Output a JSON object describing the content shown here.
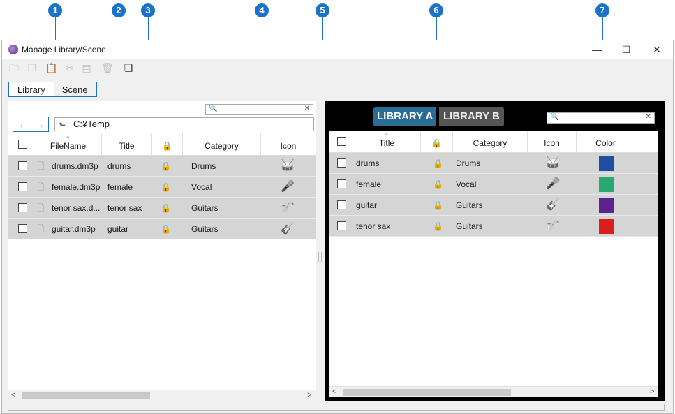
{
  "window": {
    "title": "Manage Library/Scene",
    "minimize": "—",
    "maximize": "☐",
    "close": "✕"
  },
  "callouts": [
    "1",
    "2",
    "3",
    "4",
    "5",
    "6",
    "7"
  ],
  "tabs": [
    {
      "label": "Library"
    },
    {
      "label": "Scene"
    }
  ],
  "left": {
    "path": "C:¥Temp",
    "search_placeholder": "",
    "back": "←",
    "forward": "→",
    "columns": [
      "FileName",
      "Title",
      "🔒",
      "Category",
      "Icon"
    ],
    "rows": [
      {
        "filename": "drums.dm3p",
        "title": "drums",
        "lock": "🔒",
        "category": "Drums",
        "icon": "drum-kit-icon",
        "glyph": "🥁"
      },
      {
        "filename": "female.dm3p",
        "title": "female",
        "lock": "🔒",
        "category": "Vocal",
        "icon": "microphone-icon",
        "glyph": "🎤"
      },
      {
        "filename": "tenor sax.d...",
        "title": "tenor sax",
        "lock": "🔒",
        "category": "Guitars",
        "icon": "saxophone-icon",
        "glyph": "🎷"
      },
      {
        "filename": "guitar.dm3p",
        "title": "guitar",
        "lock": "🔒",
        "category": "Guitars",
        "icon": "guitar-icon",
        "glyph": "🎸"
      }
    ]
  },
  "right": {
    "library_a": "LIBRARY A",
    "library_b": "LIBRARY B",
    "columns": [
      "Title",
      "🔒",
      "Category",
      "Icon",
      "Color"
    ],
    "rows": [
      {
        "title": "drums",
        "lock": "🔒",
        "category": "Drums",
        "icon": "drum-kit-icon",
        "glyph": "🥁",
        "color": "#1e4fa0"
      },
      {
        "title": "female",
        "lock": "🔒",
        "category": "Vocal",
        "icon": "microphone-icon",
        "glyph": "🎤",
        "color": "#2aa872"
      },
      {
        "title": "guitar",
        "lock": "🔒",
        "category": "Guitars",
        "icon": "guitar-icon",
        "glyph": "🎸",
        "color": "#5a2390"
      },
      {
        "title": "tenor sax",
        "lock": "🔒",
        "category": "Guitars",
        "icon": "saxophone-icon",
        "glyph": "🎷",
        "color": "#d81e1e"
      }
    ]
  },
  "colors": {
    "accent": "#1a73c8",
    "row_bg": "#d5d5d5"
  }
}
